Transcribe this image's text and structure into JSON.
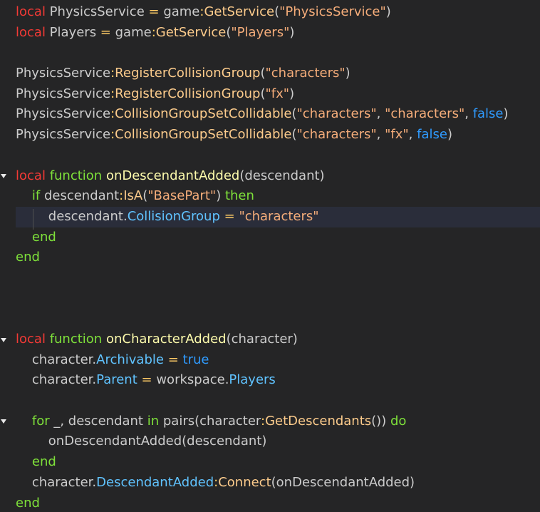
{
  "editor": {
    "language": "lua",
    "colors": {
      "background": "#252526",
      "current_line": "#2a2d3a",
      "local_keyword": "#f33a36",
      "keyword": "#7ee03a",
      "string": "#f5ad7a",
      "property": "#60c3ff",
      "boolean": "#2f9bff",
      "identifier": "#cccccc"
    },
    "fold_markers_lines": [
      9,
      17,
      21
    ],
    "current_line": 11,
    "lines": [
      [
        [
          "kw-local",
          "local"
        ],
        [
          "id",
          " PhysicsService "
        ],
        [
          "op",
          "="
        ],
        [
          "id",
          " game"
        ],
        [
          "op",
          ":"
        ],
        [
          "mth",
          "GetService"
        ],
        [
          "id",
          "("
        ],
        [
          "str",
          "\"PhysicsService\""
        ],
        [
          "id",
          ")"
        ]
      ],
      [
        [
          "kw-local",
          "local"
        ],
        [
          "id",
          " Players "
        ],
        [
          "op",
          "="
        ],
        [
          "id",
          " game"
        ],
        [
          "op",
          ":"
        ],
        [
          "mth",
          "GetService"
        ],
        [
          "id",
          "("
        ],
        [
          "str",
          "\"Players\""
        ],
        [
          "id",
          ")"
        ]
      ],
      [],
      [
        [
          "id",
          "PhysicsService"
        ],
        [
          "op",
          ":"
        ],
        [
          "mth",
          "RegisterCollisionGroup"
        ],
        [
          "id",
          "("
        ],
        [
          "str",
          "\"characters\""
        ],
        [
          "id",
          ")"
        ]
      ],
      [
        [
          "id",
          "PhysicsService"
        ],
        [
          "op",
          ":"
        ],
        [
          "mth",
          "RegisterCollisionGroup"
        ],
        [
          "id",
          "("
        ],
        [
          "str",
          "\"fx\""
        ],
        [
          "id",
          ")"
        ]
      ],
      [
        [
          "id",
          "PhysicsService"
        ],
        [
          "op",
          ":"
        ],
        [
          "mth",
          "CollisionGroupSetCollidable"
        ],
        [
          "id",
          "("
        ],
        [
          "str",
          "\"characters\""
        ],
        [
          "id",
          ", "
        ],
        [
          "str",
          "\"characters\""
        ],
        [
          "id",
          ", "
        ],
        [
          "bool",
          "false"
        ],
        [
          "id",
          ")"
        ]
      ],
      [
        [
          "id",
          "PhysicsService"
        ],
        [
          "op",
          ":"
        ],
        [
          "mth",
          "CollisionGroupSetCollidable"
        ],
        [
          "id",
          "("
        ],
        [
          "str",
          "\"characters\""
        ],
        [
          "id",
          ", "
        ],
        [
          "str",
          "\"fx\""
        ],
        [
          "id",
          ", "
        ],
        [
          "bool",
          "false"
        ],
        [
          "id",
          ")"
        ]
      ],
      [],
      [
        [
          "kw-local",
          "local"
        ],
        [
          "id",
          " "
        ],
        [
          "kw",
          "function"
        ],
        [
          "id",
          " "
        ],
        [
          "fn",
          "onDescendantAdded"
        ],
        [
          "id",
          "(descendant)"
        ]
      ],
      [
        [
          "id",
          "    "
        ],
        [
          "kw",
          "if"
        ],
        [
          "id",
          " descendant"
        ],
        [
          "op",
          ":"
        ],
        [
          "mth",
          "IsA"
        ],
        [
          "id",
          "("
        ],
        [
          "str",
          "\"BasePart\""
        ],
        [
          "id",
          ") "
        ],
        [
          "kw",
          "then"
        ]
      ],
      [
        [
          "id",
          "        descendant."
        ],
        [
          "prop",
          "CollisionGroup"
        ],
        [
          "id",
          " "
        ],
        [
          "op",
          "="
        ],
        [
          "id",
          " "
        ],
        [
          "str",
          "\"characters\""
        ]
      ],
      [
        [
          "id",
          "    "
        ],
        [
          "kw",
          "end"
        ]
      ],
      [
        [
          "kw",
          "end"
        ]
      ],
      [],
      [],
      [],
      [
        [
          "kw-local",
          "local"
        ],
        [
          "id",
          " "
        ],
        [
          "kw",
          "function"
        ],
        [
          "id",
          " "
        ],
        [
          "fn",
          "onCharacterAdded"
        ],
        [
          "id",
          "(character)"
        ]
      ],
      [
        [
          "id",
          "    character."
        ],
        [
          "prop",
          "Archivable"
        ],
        [
          "id",
          " "
        ],
        [
          "op",
          "="
        ],
        [
          "id",
          " "
        ],
        [
          "bool",
          "true"
        ]
      ],
      [
        [
          "id",
          "    character."
        ],
        [
          "prop",
          "Parent"
        ],
        [
          "id",
          " "
        ],
        [
          "op",
          "="
        ],
        [
          "id",
          " workspace."
        ],
        [
          "prop",
          "Players"
        ]
      ],
      [],
      [
        [
          "id",
          "    "
        ],
        [
          "kw",
          "for"
        ],
        [
          "id",
          " _, descendant "
        ],
        [
          "kw",
          "in"
        ],
        [
          "id",
          " pairs(character"
        ],
        [
          "op",
          ":"
        ],
        [
          "mth",
          "GetDescendants"
        ],
        [
          "id",
          "()) "
        ],
        [
          "kw",
          "do"
        ]
      ],
      [
        [
          "id",
          "        onDescendantAdded(descendant)"
        ]
      ],
      [
        [
          "id",
          "    "
        ],
        [
          "kw",
          "end"
        ]
      ],
      [
        [
          "id",
          "    character."
        ],
        [
          "prop",
          "DescendantAdded"
        ],
        [
          "op",
          ":"
        ],
        [
          "mth",
          "Connect"
        ],
        [
          "id",
          "(onDescendantAdded)"
        ]
      ],
      [
        [
          "kw",
          "end"
        ]
      ]
    ]
  }
}
